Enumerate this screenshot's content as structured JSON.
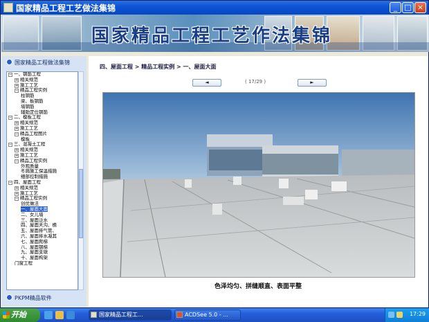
{
  "window": {
    "title": "国家精品工程工艺做法集锦"
  },
  "banner": {
    "title": "国家精品工程工艺作法集锦"
  },
  "sidebar": {
    "header": "国家精品工程做法集锦",
    "footer": "PKPM精品软件",
    "tree": [
      {
        "label": "一、钢筋工程",
        "exp": "−",
        "indent": 0
      },
      {
        "label": "相关规范",
        "exp": "+",
        "indent": 1
      },
      {
        "label": "施工工艺",
        "exp": "+",
        "indent": 1
      },
      {
        "label": "精品工程实例",
        "exp": "−",
        "indent": 1
      },
      {
        "label": "柱钢筋",
        "exp": "",
        "indent": 2
      },
      {
        "label": "梁、板钢筋",
        "exp": "",
        "indent": 2
      },
      {
        "label": "墙钢筋",
        "exp": "",
        "indent": 2
      },
      {
        "label": "辅助定位钢筋",
        "exp": "",
        "indent": 2
      },
      {
        "label": "二、模板工程",
        "exp": "−",
        "indent": 0
      },
      {
        "label": "相关规范",
        "exp": "+",
        "indent": 1
      },
      {
        "label": "施工工艺",
        "exp": "+",
        "indent": 1
      },
      {
        "label": "精品工程图片",
        "exp": "−",
        "indent": 1
      },
      {
        "label": "模板",
        "exp": "",
        "indent": 2
      },
      {
        "label": "三、混凝土工程",
        "exp": "−",
        "indent": 0
      },
      {
        "label": "相关规范",
        "exp": "+",
        "indent": 1
      },
      {
        "label": "施工工艺",
        "exp": "+",
        "indent": 1
      },
      {
        "label": "精品工程实例",
        "exp": "−",
        "indent": 1
      },
      {
        "label": "外观质量",
        "exp": "",
        "indent": 2
      },
      {
        "label": "冬施施工保温措施",
        "exp": "",
        "indent": 2
      },
      {
        "label": "细部控制措施",
        "exp": "",
        "indent": 2
      },
      {
        "label": "四、屋面工程",
        "exp": "−",
        "indent": 0
      },
      {
        "label": "相关规范",
        "exp": "+",
        "indent": 1
      },
      {
        "label": "施工工艺",
        "exp": "+",
        "indent": 1
      },
      {
        "label": "精品工程实例",
        "exp": "−",
        "indent": 1
      },
      {
        "label": "创优做法",
        "exp": "",
        "indent": 2
      },
      {
        "label": "一、屋面大面",
        "exp": "",
        "indent": 2,
        "selected": true
      },
      {
        "label": "二、女儿墙",
        "exp": "",
        "indent": 2
      },
      {
        "label": "三、屋面泛水",
        "exp": "",
        "indent": 2
      },
      {
        "label": "四、屋面天沟、檐",
        "exp": "",
        "indent": 2
      },
      {
        "label": "五、屋面排气管、",
        "exp": "",
        "indent": 2
      },
      {
        "label": "六、屋面排水凝其",
        "exp": "",
        "indent": 2
      },
      {
        "label": "七、屋面爬梯",
        "exp": "",
        "indent": 2
      },
      {
        "label": "八、屋面钢梯",
        "exp": "",
        "indent": 2
      },
      {
        "label": "九、屋面支墩",
        "exp": "",
        "indent": 2
      },
      {
        "label": "十、屋面构架",
        "exp": "",
        "indent": 2
      },
      {
        "label": "门窗工程",
        "exp": "",
        "indent": 1
      }
    ]
  },
  "content": {
    "breadcrumb": "四、屋面工程 > 精品工程实例 > 一、屋面大面",
    "prev_label": "◄",
    "next_label": "►",
    "page_indicator": "( 17/29 )",
    "caption": "色泽均匀、拼缝顺直、表面平整"
  },
  "taskbar": {
    "start_label": "开始",
    "tasks": [
      {
        "label": "国家精品工程工...",
        "active": true
      },
      {
        "label": "ACDSee 5.0 - ...",
        "active": false
      }
    ],
    "clock": "17:29"
  },
  "colors": {
    "titlebar": "#0a54d8",
    "sidebar_bg": "#d6e3f5",
    "selection": "#2f5fc8",
    "taskbar": "#245edb",
    "start_button": "#2f8a2f"
  }
}
